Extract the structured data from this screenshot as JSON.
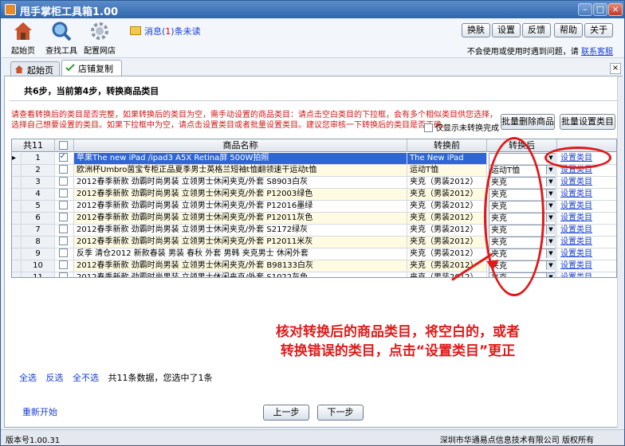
{
  "window": {
    "title": "甩手掌柜工具箱1.00"
  },
  "toolbar": {
    "tools": [
      {
        "label": "起始页",
        "icon": "home-icon"
      },
      {
        "label": "查找工具",
        "icon": "magnifier-icon"
      },
      {
        "label": "配置网店",
        "icon": "gear-icon"
      }
    ],
    "message": {
      "prefix": "消息(",
      "count": "1",
      "suffix": ")条未读"
    },
    "buttons": [
      "换肤",
      "设置",
      "反馈",
      "帮助",
      "关于"
    ],
    "help_text": "不会使用或使用时遇到问题，请",
    "help_link": "联系客服"
  },
  "tabs": [
    {
      "label": "起始页"
    },
    {
      "label": "店铺复制"
    }
  ],
  "step": {
    "text": "共6步，当前第4步，转换商品类目"
  },
  "warning": "请查看转换后的类目是否完整，如果转换后的类目为空，需手动设置的商品类目：请点击空白类目的下拉框，会有多个相似类目供您选择，选择自己想要设置的类目。如果下拉框中为空，请点击设置类目或者批量设置类目。建议您审核一下转换后的类目是否正确。",
  "only_unfinished": "仅显示未转换完成",
  "batch_buttons": {
    "delete": "批量删除商品",
    "set": "批量设置类目"
  },
  "grid": {
    "headers": {
      "count": "共11",
      "name": "商品名称",
      "before": "转换前",
      "after": "转换后"
    },
    "rows": [
      {
        "n": "1",
        "checked": true,
        "name": "苹果The new iPad /ipad3 A5X Retina屏 500W拍照",
        "before": "The New iPad",
        "after": "",
        "action": "设置类目"
      },
      {
        "n": "2",
        "checked": false,
        "name": "欧洲杯Umbro茵宝专柜正品夏季男士英格兰短袖t恤翻领速干运动t恤",
        "before": "运动T恤",
        "after": "运动T恤",
        "action": "设置类目"
      },
      {
        "n": "3",
        "checked": false,
        "name": "2012春季新款 劲霸时尚男装 立领男士休闲夹克/外套 S8903白灰",
        "before": "夹克（男装2012）",
        "after": "夹克",
        "action": "设置类目"
      },
      {
        "n": "4",
        "checked": false,
        "name": "2012春季新款 劲霸时尚男装 立领男士休闲夹克/外套 P12003绿色",
        "before": "夹克（男装2012）",
        "after": "夹克",
        "action": "设置类目"
      },
      {
        "n": "5",
        "checked": false,
        "name": "2012春季新款 劲霸时尚男装 立领男士休闲夹克/外套 P12016墨绿",
        "before": "夹克（男装2012）",
        "after": "夹克",
        "action": "设置类目"
      },
      {
        "n": "6",
        "checked": false,
        "name": "2012春季新款 劲霸时尚男装 立领男士休闲夹克/外套 P12011灰色",
        "before": "夹克（男装2012）",
        "after": "夹克",
        "action": "设置类目"
      },
      {
        "n": "7",
        "checked": false,
        "name": "2012春季新款 劲霸时尚男装 立领男士休闲夹克/外套 S2172绿灰",
        "before": "夹克（男装2012）",
        "after": "夹克",
        "action": "设置类目"
      },
      {
        "n": "8",
        "checked": false,
        "name": "2012春季新款 劲霸时尚男装 立领男士休闲夹克/外套 P12011米灰",
        "before": "夹克（男装2012）",
        "after": "夹克",
        "action": "设置类目"
      },
      {
        "n": "9",
        "checked": false,
        "name": "反季 清仓2012 新款春装 男装 春秋 外套 男韩 夹克男士 休闲外套",
        "before": "夹克（男装2012）",
        "after": "夹克",
        "action": "设置类目"
      },
      {
        "n": "10",
        "checked": false,
        "name": "2012春季新款 劲霸时尚男装 立领男士休闲夹克/外套 B98133白灰",
        "before": "夹克（男装2012）",
        "after": "夹克",
        "action": "设置类目"
      },
      {
        "n": "11",
        "checked": false,
        "name": "2012春季新款 劲霸时尚男装 立领男士休闲夹克/外套 S1022灰色",
        "before": "夹克（男装2012）",
        "after": "夹克",
        "action": "设置类目"
      }
    ]
  },
  "annotation": {
    "line1": "核对转换后的商品类目，将空白的，或者",
    "line2": "转换错误的类目，点击“设置类目”更正"
  },
  "select_links": {
    "all": "全选",
    "invert": "反选",
    "none": "全不选",
    "summary": "共11条数据，您选中了1条"
  },
  "restart": "重新开始",
  "nav": {
    "prev": "上一步",
    "next": "下一步"
  },
  "status": {
    "version": "版本号1.00.31",
    "copyright": "深圳市华通易点信息技术有限公司 版权所有"
  }
}
